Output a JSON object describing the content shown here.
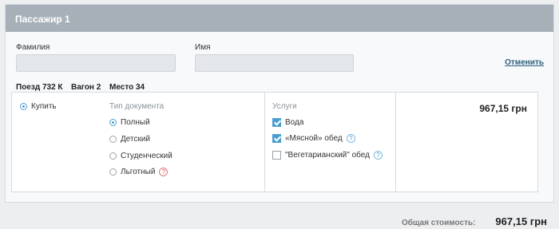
{
  "passenger": {
    "title": "Пассажир 1",
    "surname_label": "Фамилия",
    "surname_value": "",
    "name_label": "Имя",
    "name_value": "",
    "cancel_label": "Отменить"
  },
  "trip": {
    "train": "Поезд 732 К",
    "wagon": "Вагон 2",
    "seat": "Место 34"
  },
  "options": {
    "buy_label": "Купить",
    "doc_type_title": "Тип документа",
    "doc_types": [
      "Полный",
      "Детский",
      "Студенческий",
      "Льготный"
    ],
    "selected_doc_type": "Полный",
    "services_title": "Услуги",
    "services": [
      {
        "label": "Вода",
        "checked": true
      },
      {
        "label": "«Мясной» обед",
        "checked": true
      },
      {
        "label": "\"Вегетарианский\" обед",
        "checked": false
      }
    ],
    "price": "967,15 грн"
  },
  "total": {
    "label": "Общая стоимость:",
    "value": "967,15 грн"
  },
  "icons": {
    "help": "?"
  },
  "colors": {
    "header": "#a7b0b9",
    "accent": "#4a9fd0",
    "link": "#2b5f7a",
    "warning": "#d9534f"
  }
}
